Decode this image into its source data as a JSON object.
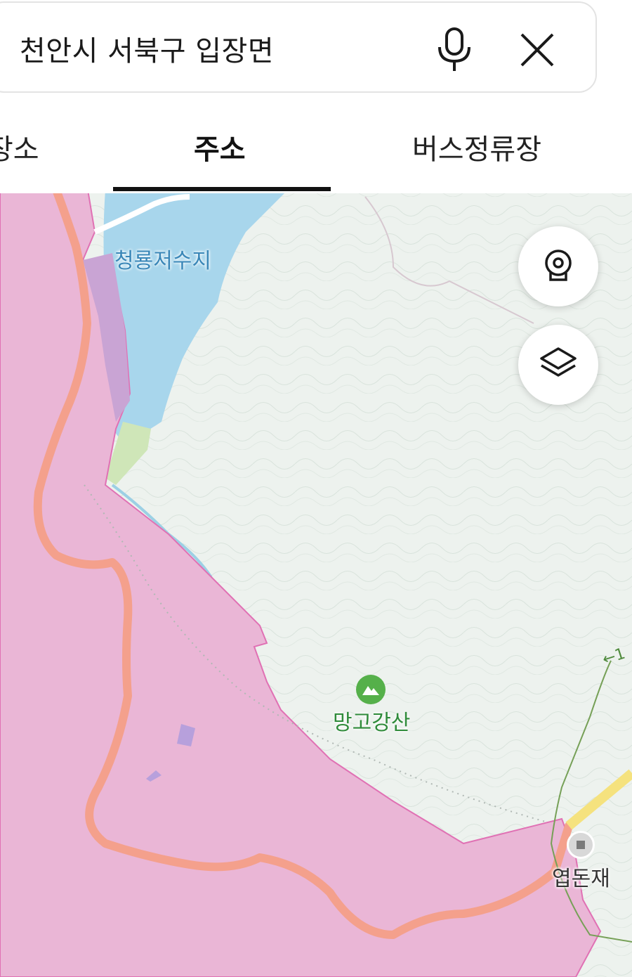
{
  "search": {
    "query": "천안시 서북구 입장면"
  },
  "icons": {
    "mic": "microphone-icon",
    "close": "close-icon",
    "cctv": "cctv-icon",
    "layers": "layers-icon",
    "mountain": "mountain-icon",
    "pass": "pass-marker-icon"
  },
  "tabs": [
    {
      "label": "장소",
      "visible_label": "장소",
      "selected": false
    },
    {
      "label": "주소",
      "selected": true
    },
    {
      "label": "버스정류장",
      "selected": false
    }
  ],
  "map": {
    "labels": {
      "reservoir": "청룡저수지",
      "mountain": "망고강산",
      "pass": "엽돈재",
      "trail": "←1"
    },
    "colors": {
      "zone_pink": "#eab6d6",
      "zone_border": "#e071b4",
      "road_salmon": "#f4a08c",
      "water": "#a8d6ec",
      "land": "#edf2ee",
      "highway": "#f5e27e",
      "trail": "#76a057"
    }
  }
}
